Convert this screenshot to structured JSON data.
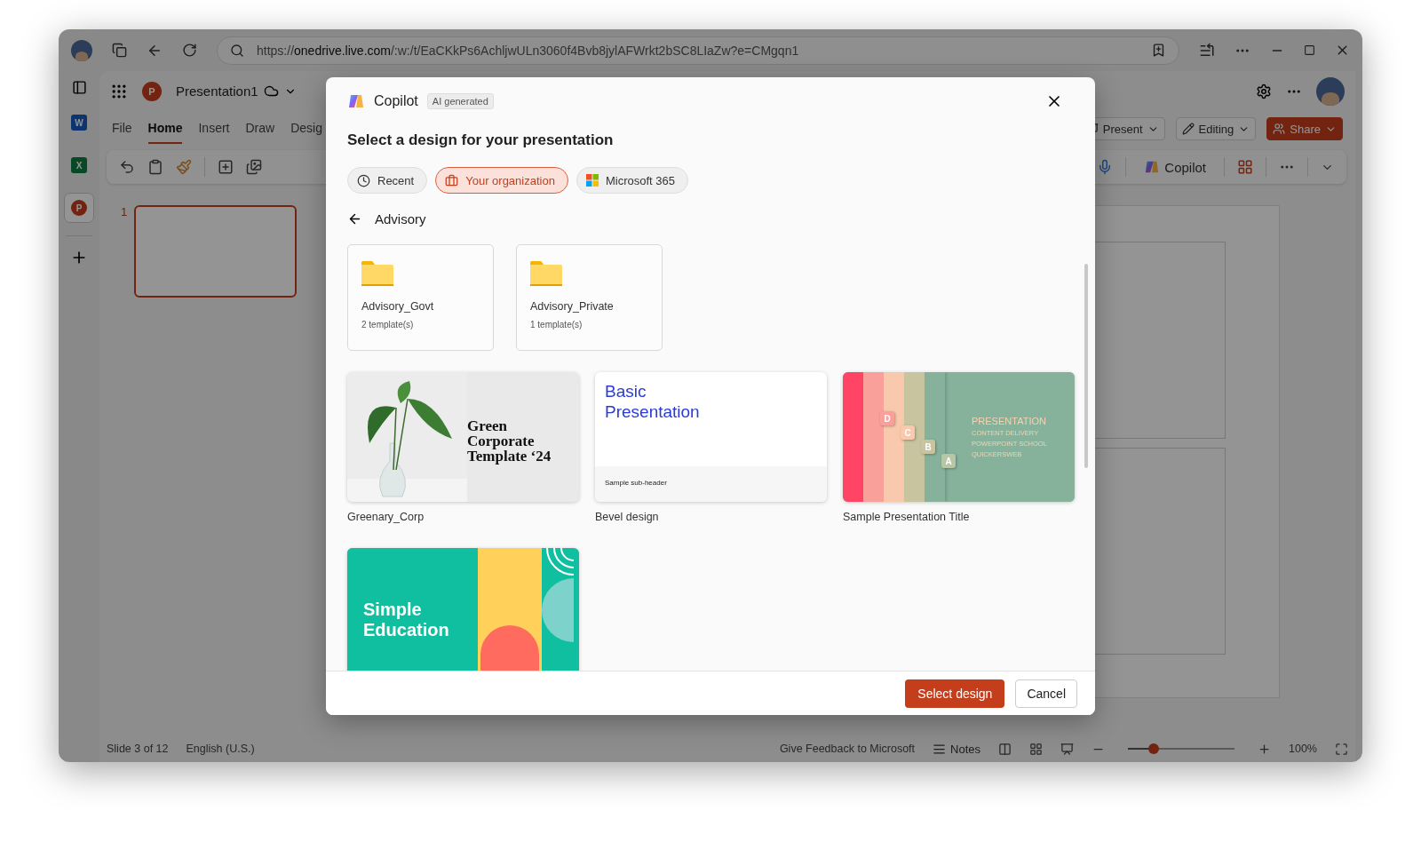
{
  "browser": {
    "url": "https://**onedrive.live.com**/:w:/t/EaCKkPs6AchljwULn3060f4Bvb8jylAFWrkt2bSC8LIaZw?e=CMgqn1"
  },
  "rail": {
    "apps": [
      {
        "letter": "W",
        "kind": "word",
        "selected": false
      },
      {
        "letter": "X",
        "kind": "excel",
        "selected": false
      },
      {
        "letter": "P",
        "kind": "powerpoint",
        "selected": true
      }
    ]
  },
  "app": {
    "logo_letter": "P",
    "title": "Presentation1",
    "tabs": [
      {
        "label": "File",
        "selected": false
      },
      {
        "label": "Home",
        "selected": true
      },
      {
        "label": "Insert",
        "selected": false
      },
      {
        "label": "Draw",
        "selected": false
      },
      {
        "label": "Desig",
        "selected": false
      }
    ],
    "present": "Present",
    "editing": "Editing",
    "share": "Share",
    "copilot": "Copilot"
  },
  "slides": [
    {
      "number": "1",
      "selected": true
    }
  ],
  "status_bar": {
    "slide": "Slide 3 of 12",
    "language": "English (U.S.)",
    "feedback": "Give Feedback to Microsoft",
    "notes": "Notes",
    "zoom": {
      "level": 0.24
    },
    "zoom_reading": "100%"
  },
  "dialog": {
    "title": "Copilot",
    "badge": "AI generated",
    "heading": "Select a design for your presentation",
    "filters": [
      {
        "label": "Recent",
        "kind": "recent",
        "selected": false
      },
      {
        "label": "Your organization",
        "kind": "organization",
        "selected": true
      },
      {
        "label": "Microsoft 365",
        "kind": "microsoft",
        "selected": false
      }
    ],
    "breadcrumb": "Advisory",
    "folders": [
      {
        "name": "Advisory_Govt",
        "count": "2 template(s)"
      },
      {
        "name": "Advisory_Private",
        "count": "1 template(s)"
      }
    ],
    "templates": [
      {
        "kind": "greenery",
        "name": "Greenary_Corp",
        "title": "Green Corporate Template ‘24"
      },
      {
        "kind": "bevel",
        "name": "Bevel design",
        "title": "Basic Presentation",
        "subheader": "Sample sub-header"
      },
      {
        "kind": "tabs",
        "name": "Sample Presentation Title",
        "title": "PRESENTATION",
        "lines": [
          "CONTENT DELIVERY",
          "POWERPOINT SCHOOL",
          "QUICKERSWEB"
        ],
        "tabs": [
          "D",
          "C",
          "B",
          "A"
        ]
      },
      {
        "kind": "education",
        "title": "Simple Education"
      }
    ],
    "primary_button": "Select design",
    "cancel_button": "Cancel"
  }
}
